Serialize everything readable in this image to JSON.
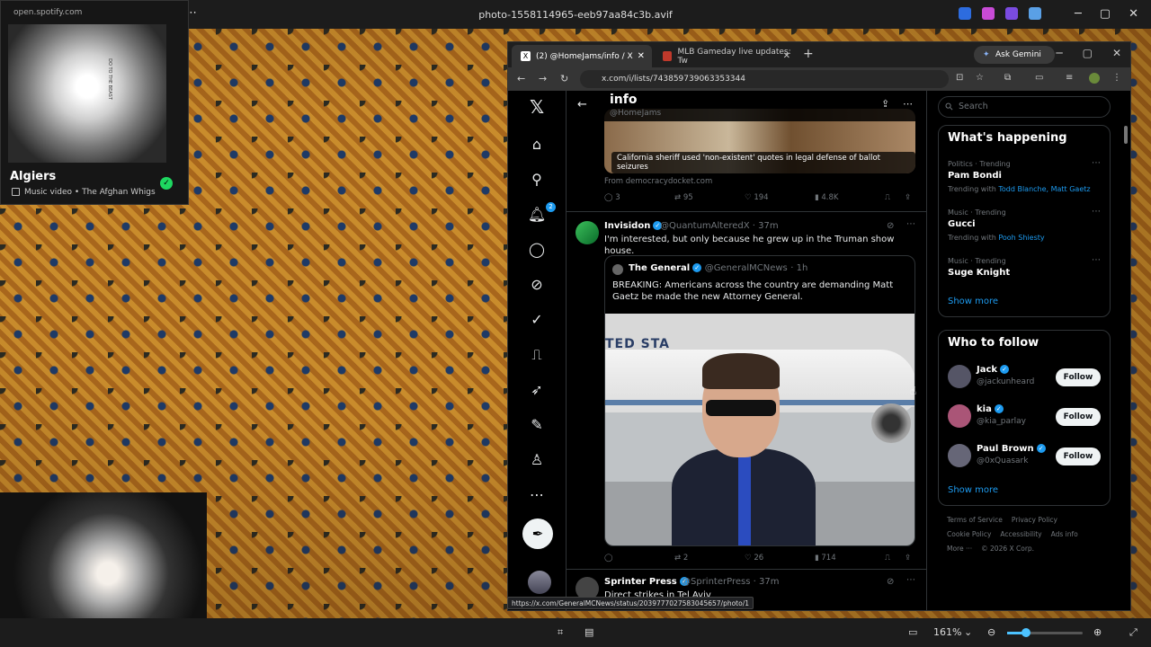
{
  "window": {
    "filename": "photo-1558114965-eeb97aa84c3b.avif",
    "more": "⋯"
  },
  "spotify": {
    "url": "open.spotify.com",
    "song": "Algiers",
    "kind": "Music video",
    "artist": "The Afghan Whigs",
    "cover_text": "DO TO THE BEAST"
  },
  "browser": {
    "tabs": [
      {
        "label": "(2) @HomeJams/info / X"
      },
      {
        "label": "MLB Gameday live updates: Tw"
      }
    ],
    "gemini": "Ask Gemini",
    "url": "x.com/i/lists/743859739063353344",
    "status_url": "https://x.com/GeneralMCNews/status/2039777027583045657/photo/1"
  },
  "x": {
    "header": {
      "title": "info",
      "handle": "@HomeJams"
    },
    "card": {
      "caption": "California sheriff used 'non-existent' quotes in legal defense of ballot seizures",
      "source": "From democracydocket.com",
      "actions": {
        "replies": "3",
        "reposts": "95",
        "likes": "194",
        "views": "4.8K"
      }
    },
    "tweet1": {
      "name": "Invisidon",
      "handle": "@QuantumAlteredX",
      "time": "· 37m",
      "text": "I'm interested, but only because he grew up in the Truman show house.",
      "quote": {
        "name": "The General",
        "handle": "@GeneralMCNews",
        "time": "· 1h",
        "text": "BREAKING: Americans across the country are demanding Matt Gaetz be made the new Attorney General.",
        "plane_text": "TED STA"
      },
      "actions": {
        "reposts": "2",
        "likes": "26",
        "views": "714"
      }
    },
    "tweet2": {
      "name": "Sprinter Press",
      "handle": "@SprinterPress",
      "time": "· 37m",
      "text": "Direct strikes in Tel Aviv"
    },
    "search_placeholder": "Search",
    "happening": {
      "title": "What's happening",
      "items": [
        {
          "category": "Politics · Trending",
          "name": "Pam Bondi",
          "with_label": "Trending with",
          "with": "Todd Blanche, Matt Gaetz"
        },
        {
          "category": "Music · Trending",
          "name": "Gucci",
          "with_label": "Trending with",
          "with": "Pooh Shiesty"
        },
        {
          "category": "Music · Trending",
          "name": "Suge Knight",
          "with_label": "",
          "with": ""
        }
      ],
      "show_more": "Show more"
    },
    "who": {
      "title": "Who to follow",
      "items": [
        {
          "name": "Jack",
          "handle": "@jackunheard",
          "btn": "Follow"
        },
        {
          "name": "kia",
          "handle": "@kia_parlay",
          "btn": "Follow"
        },
        {
          "name": "Paul Brown",
          "handle": "@0xQuasark",
          "btn": "Follow"
        }
      ],
      "show_more": "Show more"
    },
    "footer": [
      "Terms of Service",
      "Privacy Policy",
      "Cookie Policy",
      "Accessibility",
      "Ads info",
      "More ···",
      "© 2026 X Corp."
    ],
    "notif_count": "2"
  },
  "viewer": {
    "zoom": "161%"
  }
}
